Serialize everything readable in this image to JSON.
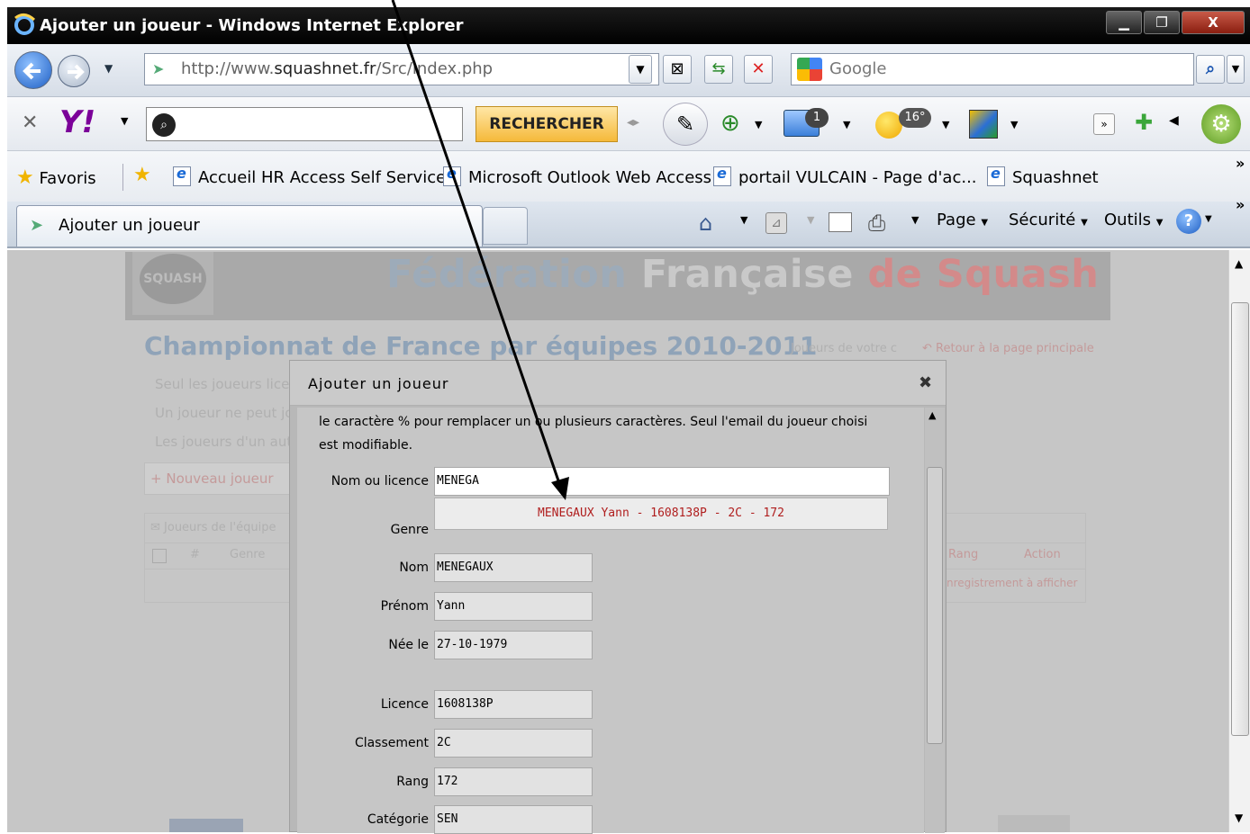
{
  "window": {
    "title": "Ajouter un joueur - Windows Internet Explorer"
  },
  "nav": {
    "url_prefix": "http://www.",
    "url_domain": "squashnet.fr",
    "url_path": "/Src/index.php",
    "search_placeholder": "Google"
  },
  "yahoo": {
    "logo": "Y!",
    "search_button": "RECHERCHER",
    "mail_count": "1",
    "weather": "16°"
  },
  "favorites": {
    "label": "Favoris",
    "items": [
      "Accueil HR Access Self Service",
      "Microsoft Outlook Web Access",
      "portail VULCAIN - Page d'ac...",
      "Squashnet"
    ]
  },
  "tabs": {
    "active": "Ajouter un joueur"
  },
  "commands": {
    "page": "Page",
    "security": "Sécurité",
    "tools": "Outils"
  },
  "page": {
    "brand_1": "Fédération",
    "brand_2": "Française",
    "brand_3": "de Squash",
    "brand_color_1": "#9dabb9",
    "brand_color_3": "#d38a8a",
    "heading": "Championnat de France par équipes 2010-2011",
    "subtitle": "Joueurs de votre c",
    "back_link": "Retour à la page principale",
    "info_1": "Seul les joueurs licen",
    "info_2": "Un joueur ne peut jo",
    "info_3": "Les joueurs d'un aut",
    "new_player": "Nouveau joueur",
    "team_box": "Joueurs de l'équipe",
    "col_hash": "#",
    "col_genre": "Genre",
    "col_rang": "Rang",
    "col_action": "Action",
    "empty_msg": "nregistrement à afficher"
  },
  "modal": {
    "title": "Ajouter un joueur",
    "help_1": "le caractère % pour remplacer un ou plusieurs caractères. Seul l'email du joueur choisi",
    "help_2": "est modifiable.",
    "fields": {
      "name_label": "Nom ou licence",
      "name_value": "MENEGA",
      "genre_label": "Genre",
      "nom_label": "Nom",
      "nom_value": "MENEGAUX",
      "prenom_label": "Prénom",
      "prenom_value": "Yann",
      "nee_label": "Née le",
      "nee_value": "27-10-1979",
      "licence_label": "Licence",
      "licence_value": "1608138P",
      "classement_label": "Classement",
      "classement_value": "2C",
      "rang_label": "Rang",
      "rang_value": "172",
      "categorie_label": "Catégorie",
      "categorie_value": "SEN"
    },
    "suggestion": "MENEGAUX Yann - 1608138P - 2C - 172"
  }
}
